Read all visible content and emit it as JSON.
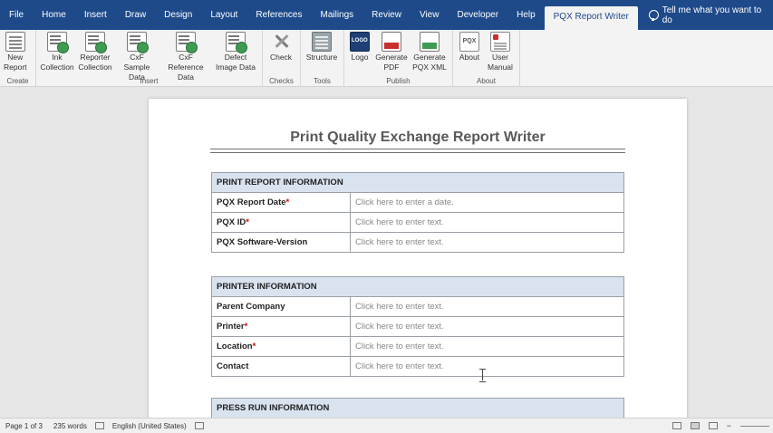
{
  "tabs": [
    {
      "label": "File"
    },
    {
      "label": "Home"
    },
    {
      "label": "Insert"
    },
    {
      "label": "Draw"
    },
    {
      "label": "Design"
    },
    {
      "label": "Layout"
    },
    {
      "label": "References"
    },
    {
      "label": "Mailings"
    },
    {
      "label": "Review"
    },
    {
      "label": "View"
    },
    {
      "label": "Developer"
    },
    {
      "label": "Help"
    },
    {
      "label": "PQX Report Writer"
    }
  ],
  "tell_me": "Tell me what you want to do",
  "ribbon": {
    "groups": [
      {
        "label": "Create",
        "buttons": [
          {
            "label": "New\nReport",
            "icon": "new-report-icon"
          }
        ]
      },
      {
        "label": "Insert",
        "buttons": [
          {
            "label": "Ink\nCollection",
            "icon": "ink-collection-icon"
          },
          {
            "label": "Reporter\nCollection",
            "icon": "reporter-collection-icon"
          },
          {
            "label": "CxF Sample\nData",
            "icon": "cxf-sample-icon"
          },
          {
            "label": "CxF Reference\nData",
            "icon": "cxf-reference-icon"
          },
          {
            "label": "Defect\nImage Data",
            "icon": "defect-image-icon"
          }
        ]
      },
      {
        "label": "Checks",
        "buttons": [
          {
            "label": "Check",
            "icon": "check-tools-icon"
          }
        ]
      },
      {
        "label": "Tools",
        "buttons": [
          {
            "label": "Structure",
            "icon": "structure-icon"
          }
        ]
      },
      {
        "label": "Publish",
        "buttons": [
          {
            "label": "Logo",
            "icon": "logo-icon"
          },
          {
            "label": "Generate\nPDF",
            "icon": "generate-pdf-icon"
          },
          {
            "label": "Generate\nPQX XML",
            "icon": "generate-xml-icon"
          }
        ]
      },
      {
        "label": "About",
        "buttons": [
          {
            "label": "About",
            "icon": "pqx-about-icon"
          },
          {
            "label": "User\nManual",
            "icon": "user-manual-icon"
          }
        ]
      }
    ]
  },
  "document": {
    "title": "Print Quality Exchange Report Writer",
    "sections": [
      {
        "header": "PRINT REPORT INFORMATION",
        "rows": [
          {
            "label": "PQX Report Date",
            "required": "*",
            "value": "Click here to enter a date."
          },
          {
            "label": "PQX ID",
            "required": "*",
            "value": "Click here to enter text."
          },
          {
            "label": "PQX Software-Version",
            "required": "",
            "value": "Click here to enter text."
          }
        ]
      },
      {
        "header": "PRINTER INFORMATION",
        "rows": [
          {
            "label": "Parent Company",
            "required": "",
            "value": "Click here to enter text."
          },
          {
            "label": "Printer",
            "required": "*",
            "value": "Click here to enter text."
          },
          {
            "label": "Location",
            "required": "*",
            "value": "Click here to enter text."
          },
          {
            "label": "Contact",
            "required": "",
            "value": "Click here to enter text."
          }
        ]
      },
      {
        "header": "PRESS RUN INFORMATION",
        "rows": []
      }
    ]
  },
  "status": {
    "page": "Page 1 of 3",
    "words": "235 words",
    "language": "English (United States)"
  },
  "colors": {
    "tab_bar": "#1e4a8a",
    "section_header": "#d9e3ef",
    "required": "#cc0000"
  }
}
